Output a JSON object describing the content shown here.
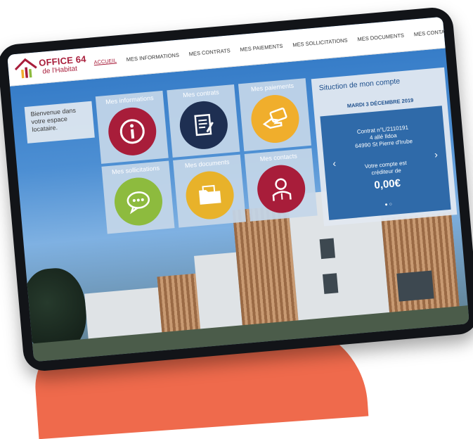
{
  "logo": {
    "line1": "OFFICE 64",
    "line2": "de l'Habitat"
  },
  "nav": {
    "items": [
      "ACCUEIL",
      "MES INFORMATIONS",
      "MES CONTRATS",
      "MES PAIEMENTS",
      "MES SOLLICITATIONS",
      "MES DOCUMENTS",
      "MES CONTACTS"
    ],
    "active": "ACCUEIL"
  },
  "welcome": {
    "text": "Bienvenue dans votre espace locataire."
  },
  "tiles": [
    {
      "label": "Mes informations",
      "icon": "info-icon",
      "color": "#a81d3a"
    },
    {
      "label": "Mes contrats",
      "icon": "document-edit-icon",
      "color": "#1e2f52"
    },
    {
      "label": "Mes paiements",
      "icon": "card-hand-icon",
      "color": "#f0ae2c"
    },
    {
      "label": "Mes sollicitations",
      "icon": "chat-bubble-icon",
      "color": "#8dbb3e"
    },
    {
      "label": "Mes documents",
      "icon": "folder-icon",
      "color": "#e8b22a"
    },
    {
      "label": "Mes contacts",
      "icon": "person-icon",
      "color": "#a81d3a"
    }
  ],
  "account": {
    "title": "Situction de mon compte",
    "date": "MARDI 3 DÉCEMBRE 2019",
    "contract": "Contrat n°L/2110191",
    "address1": "4 allé Ildoa",
    "address2": "64990 St Pierre d'Irube",
    "status1": "Votre compte est",
    "status2": "créditeur de",
    "amount": "0,00€",
    "prev": "‹",
    "next": "›",
    "dots": "●○"
  },
  "colors": {
    "brand": "#a81d3a",
    "accountPanel": "#2f6aa9",
    "blob": "#ef6a4c"
  }
}
